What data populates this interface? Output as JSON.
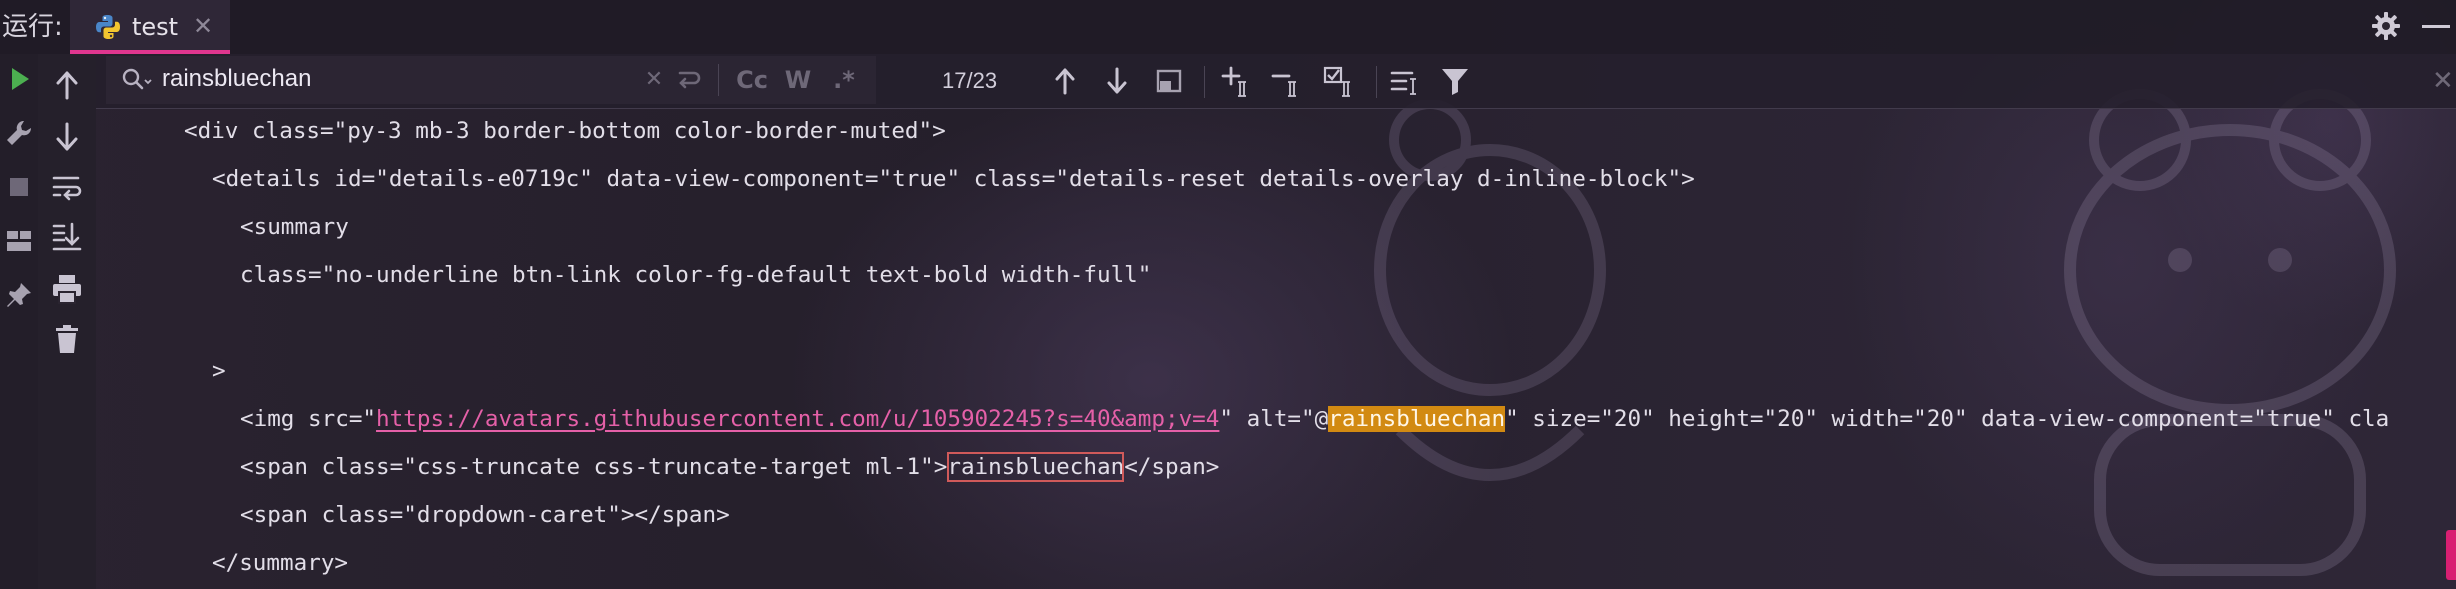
{
  "titlebar": {
    "run_label": "运行:",
    "tab": {
      "label": "test",
      "close": "✕",
      "icon": "python-icon"
    },
    "icons": [
      "gear-icon",
      "minimize-icon"
    ]
  },
  "left_toolbar": {
    "buttons": [
      "run-icon",
      "wrench-icon",
      "stop-icon",
      "layout-icon",
      "pin-icon"
    ]
  },
  "nav_toolbar": {
    "buttons": [
      "arrow-up-icon",
      "arrow-down-icon",
      "soft-wrap-icon",
      "scroll-to-end-icon",
      "print-icon",
      "trash-icon"
    ]
  },
  "find_bar": {
    "search_value": "rainsbluechan",
    "search_placeholder": "",
    "clear": "✕",
    "match_case_label": "Cc",
    "words_label": "W",
    "regex_label": ".*",
    "match_count": "17/23",
    "close": "✕",
    "icons": [
      "search-icon",
      "replace-icon",
      "prev-occurrence-icon",
      "next-occurrence-icon",
      "open-in-window-icon",
      "add-selection-icon",
      "remove-selection-icon",
      "select-all-icon",
      "multiline-icon",
      "filter-icon"
    ]
  },
  "code": {
    "line1": "<div class=\"py-3 mb-3 border-bottom color-border-muted\">",
    "line2": "<details id=\"details-e0719c\" data-view-component=\"true\" class=\"details-reset details-overlay d-inline-block\">",
    "line3": "<summary",
    "line4": "class=\"no-underline btn-link color-fg-default text-bold width-full\"",
    "line5": ">",
    "line6_pre": "<img src=\"",
    "line6_link": "https://avatars.githubusercontent.com/u/105902245?s=40&amp;v=4",
    "line6_mid": "\" alt=\"@",
    "line6_match": "rainsbluechan",
    "line6_post": "\" size=\"20\" height=\"20\" width=\"20\" data-view-component=\"true\" cla",
    "line7_pre": "<span class=\"css-truncate css-truncate-target ml-1\">",
    "line7_match": "rainsbluechan",
    "line7_post": "</span>",
    "line8": "<span class=\"dropdown-caret\"></span>",
    "line9": "</summary>"
  },
  "colors": {
    "accent": "#e0368f",
    "run_green": "#4caf50",
    "current_match": "#d28a12",
    "link": "#e560a8"
  }
}
